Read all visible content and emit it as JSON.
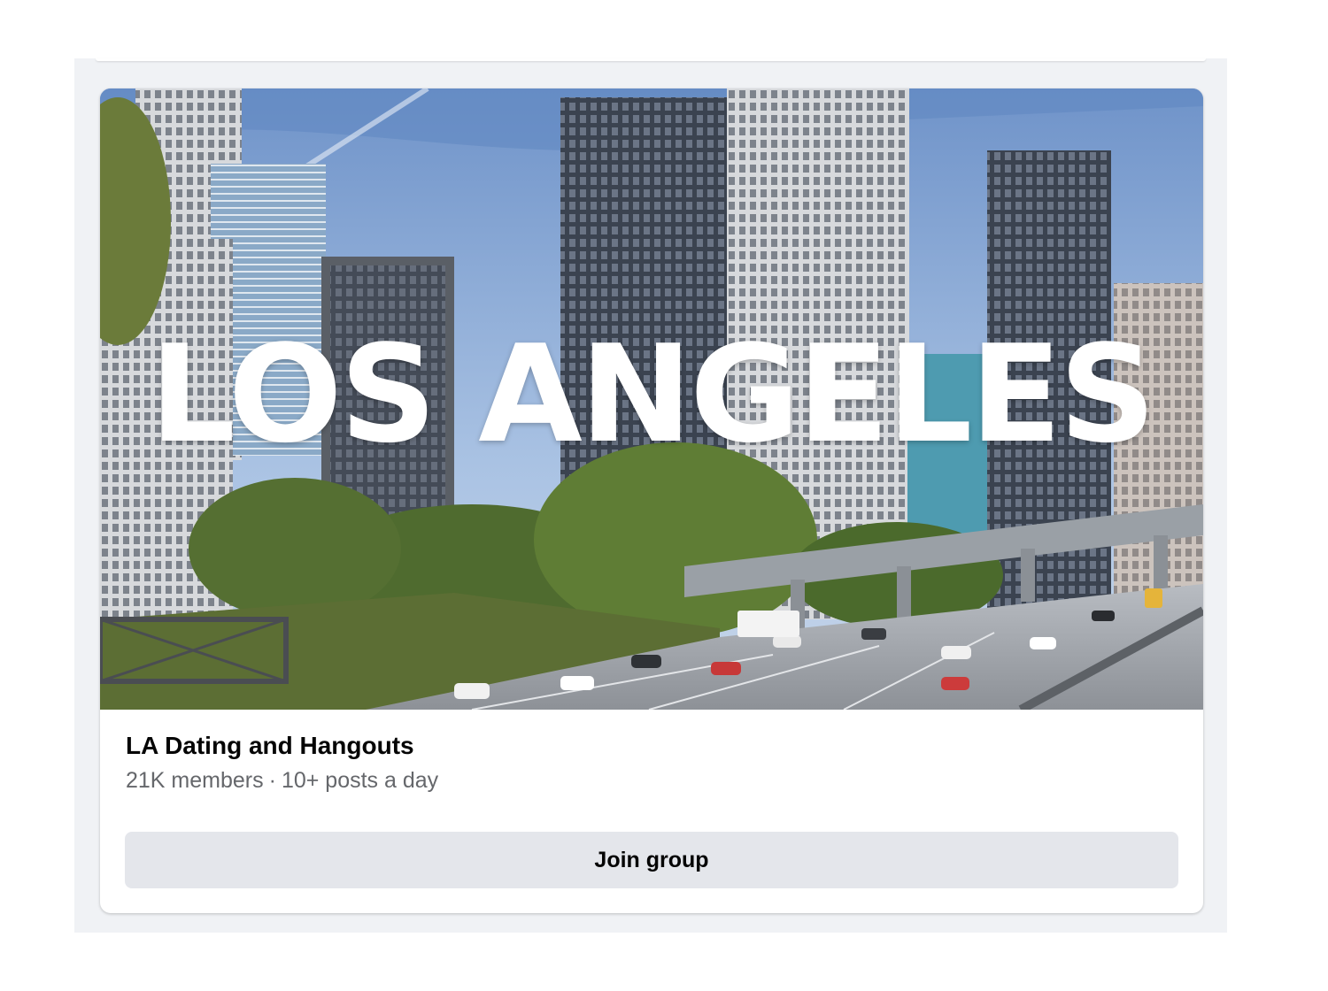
{
  "group": {
    "cover_text": "LOS ANGELES",
    "name": "LA Dating and Hangouts",
    "members": "21K members",
    "separator": "·",
    "activity": "10+ posts a day",
    "join_label": "Join group"
  },
  "colors": {
    "panel_bg": "#f0f2f5",
    "card_bg": "#ffffff",
    "button_bg": "#e4e6eb",
    "title_text": "#050505",
    "meta_text": "#65676b"
  }
}
